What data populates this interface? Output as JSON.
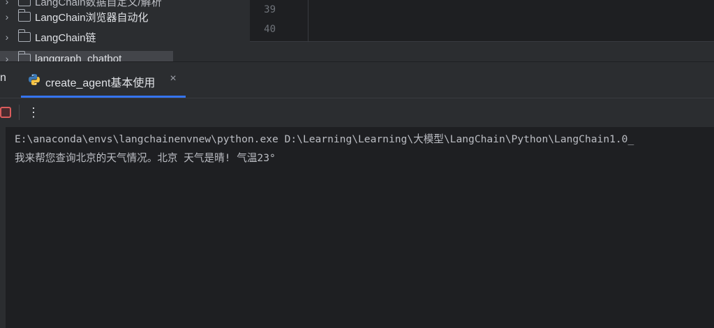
{
  "project_tree": {
    "items": [
      {
        "label": "LangChain数据自定义/解析",
        "expanded": false
      },
      {
        "label": "LangChain浏览器自动化",
        "expanded": false
      },
      {
        "label": "LangChain链",
        "expanded": false
      },
      {
        "label": "langgraph_chatbot",
        "expanded": false,
        "selected": true
      }
    ]
  },
  "editor": {
    "line_numbers": [
      "39",
      "40"
    ]
  },
  "run_window": {
    "prev_tab_tail": "n",
    "active_tab": {
      "label": "create_agent基本使用",
      "icon": "python-icon",
      "close_glyph": "×"
    }
  },
  "toolbar": {
    "stop_icon": "stop-icon",
    "more_glyph": "⋮"
  },
  "console": {
    "lines": [
      "E:\\anaconda\\envs\\langchainenvnew\\python.exe D:\\Learning\\Learning\\大模型\\LangChain\\Python\\LangChain1.0_",
      "我来帮您查询北京的天气情况。北京 天气是晴! 气温23°"
    ]
  },
  "colors": {
    "background": "#1e1f22",
    "panel": "#2b2d30",
    "accent": "#3574f0",
    "stop_red": "#db5c5c"
  }
}
